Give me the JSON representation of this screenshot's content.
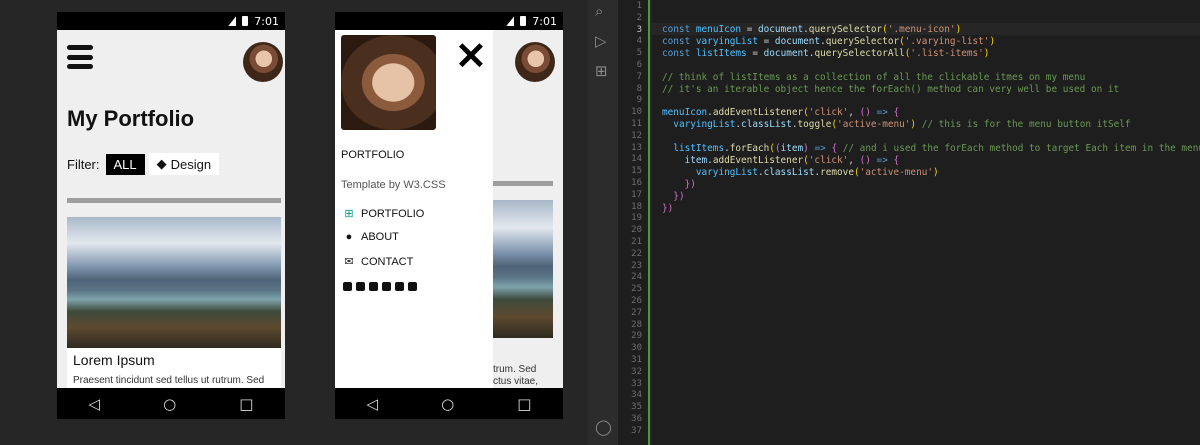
{
  "phone1": {
    "status_time": "7:01",
    "title": "My Portfolio",
    "filter_label": "Filter:",
    "filter_all": "ALL",
    "filter_design": "Design",
    "card_title": "Lorem Ipsum",
    "card_text": "Praesent tincidunt sed tellus ut rutrum. Sed"
  },
  "phone2": {
    "status_time": "7:01",
    "drawer_heading": "PORTFOLIO",
    "drawer_subtitle": "Template by W3.CSS",
    "nav_items": [
      {
        "label": "PORTFOLIO",
        "icon": "grid-icon"
      },
      {
        "label": "ABOUT",
        "icon": "user-icon"
      },
      {
        "label": "CONTACT",
        "icon": "envelope-icon"
      }
    ],
    "side_text_1": "trum. Sed",
    "side_text_2": "ctus vitae,"
  },
  "editor": {
    "lines": [
      "1",
      "2",
      "3",
      "4",
      "5",
      "6",
      "7",
      "8",
      "9",
      "10",
      "11",
      "12",
      "13",
      "14",
      "15",
      "16",
      "17",
      "18",
      "19",
      "20",
      "21",
      "22",
      "23",
      "24",
      "25",
      "26",
      "27",
      "28",
      "29",
      "30",
      "31",
      "32",
      "33",
      "34",
      "35",
      "36",
      "37"
    ],
    "current_line": "3"
  },
  "colors": {
    "editor_bg": "#1e1e1e",
    "gutter_accent": "#4d9b3a",
    "keyword": "#569cd6",
    "string": "#ce9178",
    "comment": "#6a9955"
  }
}
